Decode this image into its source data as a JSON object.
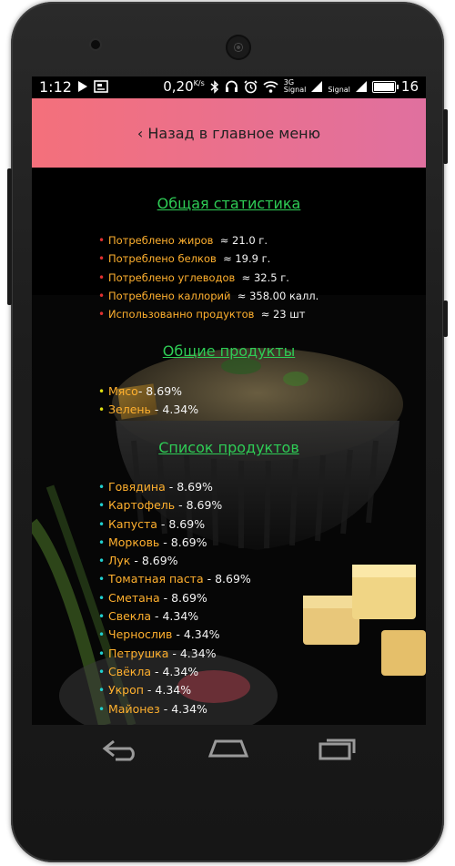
{
  "status_bar": {
    "time": "1:12",
    "speed": "0,20",
    "speed_unit": "K/s",
    "network": "3G",
    "signal_label_1": "Signal",
    "signal_label_2": "Signal",
    "battery": "16"
  },
  "header": {
    "back_label": "‹ Назад в главное меню"
  },
  "general_stats": {
    "title": "Общая статистика",
    "items": [
      {
        "label": "Потреблено жиров",
        "value": "≈ 21.0 г."
      },
      {
        "label": "Потреблено белков",
        "value": "≈ 19.9 г."
      },
      {
        "label": "Потреблено углеводов",
        "value": "≈ 32.5 г."
      },
      {
        "label": "Потреблено каллорий",
        "value": "≈ 358.00 калл."
      },
      {
        "label": "Использованно продуктов",
        "value": "≈  23 шт"
      }
    ]
  },
  "common_products": {
    "title": "Общие продукты",
    "items": [
      {
        "label": "Мясо",
        "value": "- 8.69%"
      },
      {
        "label": "Зелень",
        "value": " - 4.34%"
      }
    ]
  },
  "product_list": {
    "title": "Список продуктов",
    "items": [
      {
        "label": "Говядина",
        "value": " - 8.69%"
      },
      {
        "label": "Картофель",
        "value": " - 8.69%"
      },
      {
        "label": "Капуста",
        "value": " - 8.69%"
      },
      {
        "label": "Морковь",
        "value": " - 8.69%"
      },
      {
        "label": "Лук",
        "value": " - 8.69%"
      },
      {
        "label": "Томатная паста",
        "value": " - 8.69%"
      },
      {
        "label": "Сметана",
        "value": " - 8.69%"
      },
      {
        "label": "Свекла",
        "value": " - 4.34%"
      },
      {
        "label": "Чернослив",
        "value": " - 4.34%"
      },
      {
        "label": "Петрушка",
        "value": " - 4.34%"
      },
      {
        "label": "Свёкла",
        "value": " - 4.34%"
      },
      {
        "label": "Укроп",
        "value": " - 4.34%"
      },
      {
        "label": "Майонез",
        "value": " - 4.34%"
      }
    ]
  },
  "nav": {
    "back_icon": "back-arrow-icon",
    "home_icon": "home-icon",
    "recents_icon": "recents-icon"
  },
  "colors": {
    "header_gradient_start": "#f4707b",
    "header_gradient_end": "#e0709f",
    "section_title": "#2ecc55",
    "label": "#ffb02e",
    "value": "#f4f4f4"
  }
}
